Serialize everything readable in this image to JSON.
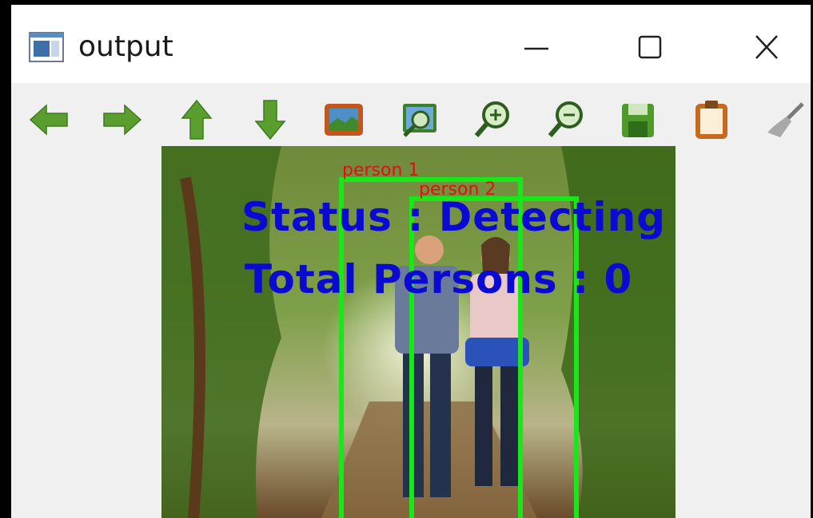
{
  "window": {
    "title": "output",
    "controls": [
      "minimize",
      "maximize",
      "close"
    ]
  },
  "toolbar": {
    "tools": [
      {
        "name": "back-arrow-icon",
        "color": "#5a9e2f"
      },
      {
        "name": "forward-arrow-icon",
        "color": "#5a9e2f"
      },
      {
        "name": "up-arrow-icon",
        "color": "#5a9e2f"
      },
      {
        "name": "down-arrow-icon",
        "color": "#5a9e2f"
      },
      {
        "name": "image-icon",
        "color": "#c0571e"
      },
      {
        "name": "zoom-image-icon",
        "color": "#3f7f2a"
      },
      {
        "name": "zoom-in-icon",
        "color": "#3f7f2a"
      },
      {
        "name": "zoom-out-icon",
        "color": "#3f7f2a"
      },
      {
        "name": "save-icon",
        "color": "#4f9a2a"
      },
      {
        "name": "clipboard-icon",
        "color": "#c86a1e"
      },
      {
        "name": "brush-icon",
        "color": "#9a9a9a"
      }
    ]
  },
  "image": {
    "status_text": "Status : Detecting",
    "total_text": "Total Persons : 0",
    "text_color": "#0a0ad2",
    "box_color": "#18e818",
    "label_color": "#e01010",
    "detections": [
      {
        "label": "person 1"
      },
      {
        "label": "person 2"
      }
    ]
  }
}
